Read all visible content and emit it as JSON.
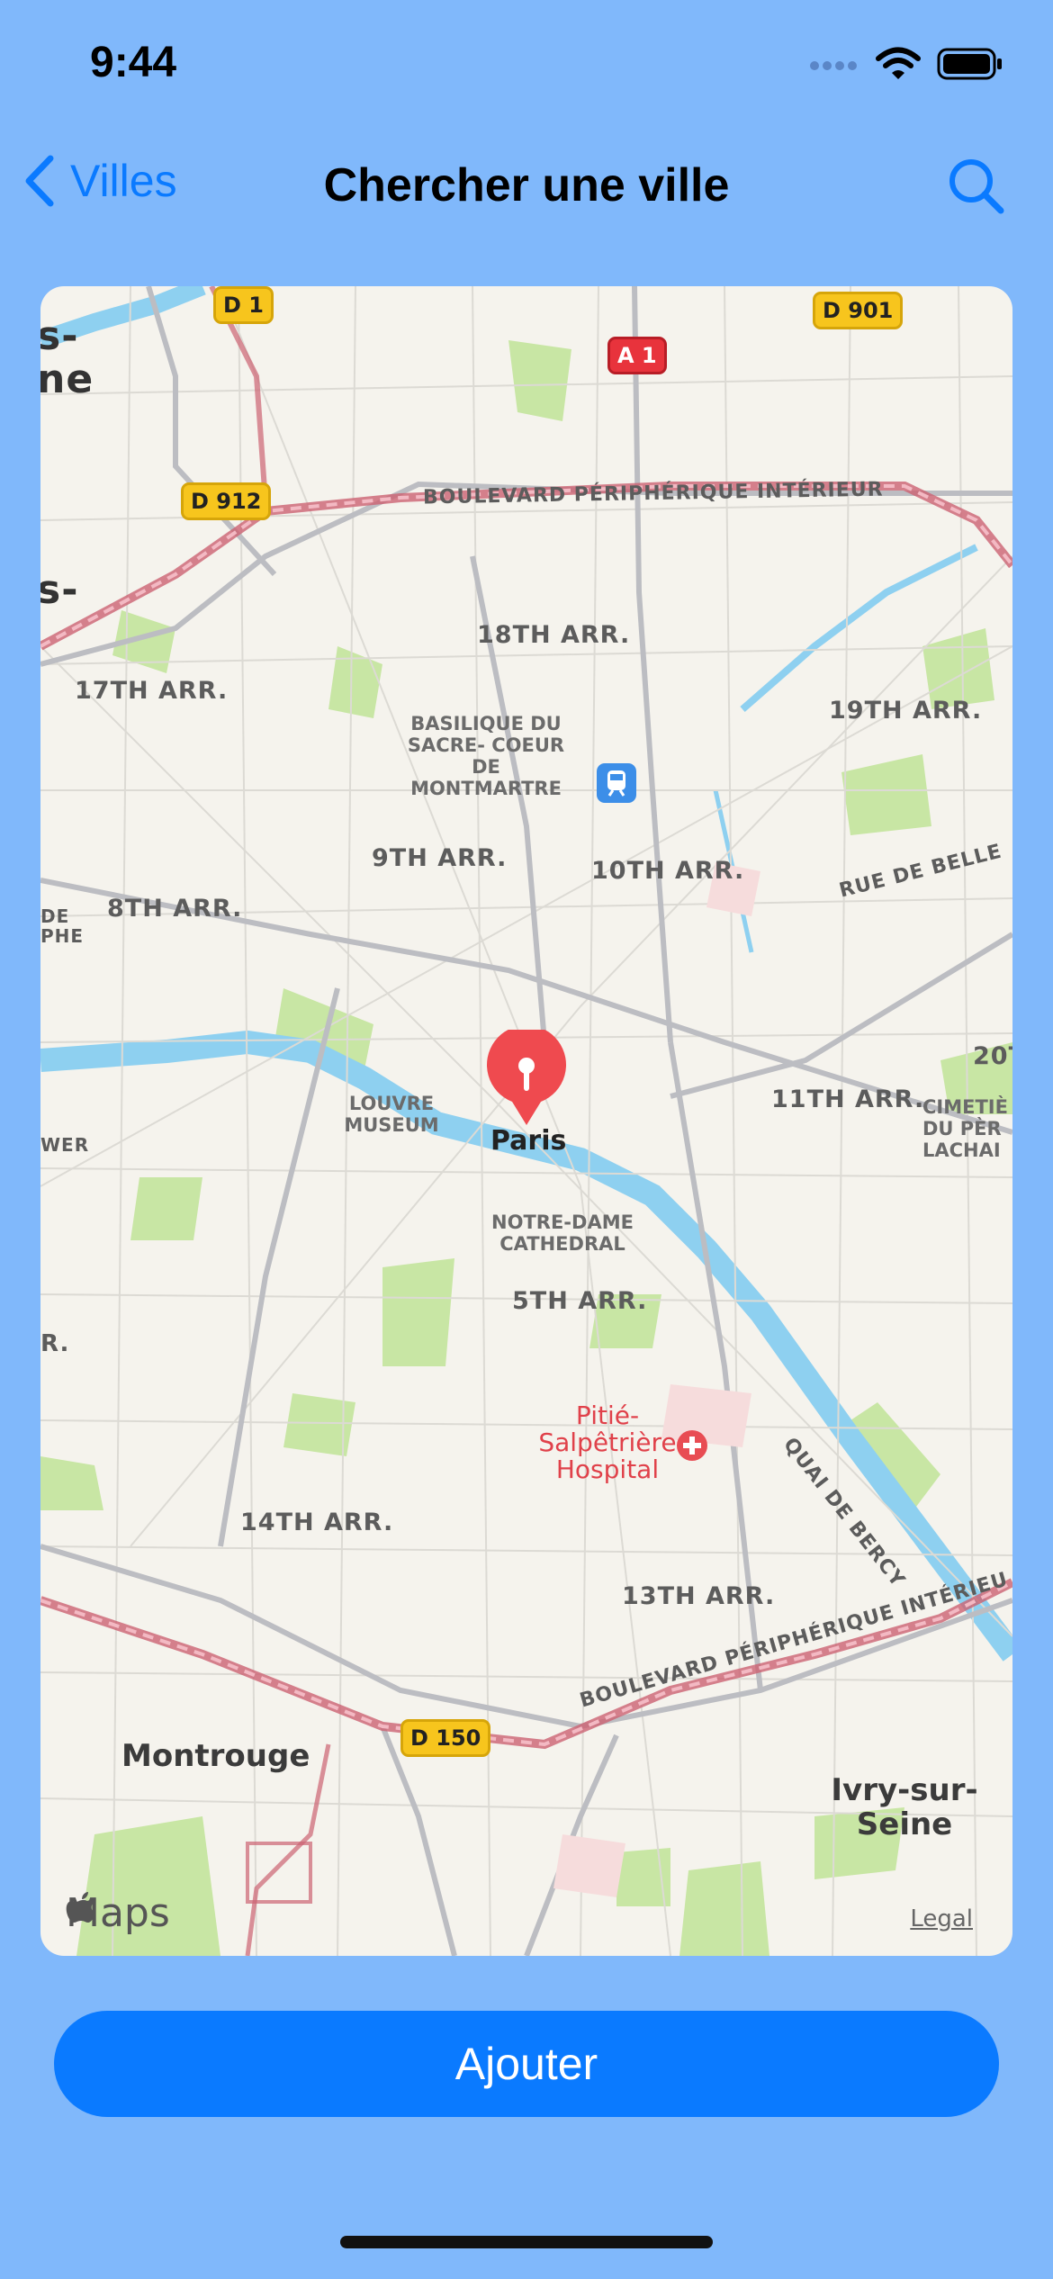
{
  "status": {
    "time": "9:44"
  },
  "nav": {
    "back_label": "Villes",
    "title": "Chercher une ville"
  },
  "map": {
    "pin_label": "Paris",
    "districts": [
      "18TH ARR.",
      "17TH ARR.",
      "19TH ARR.",
      "9TH ARR.",
      "10TH ARR.",
      "8TH ARR.",
      "11TH ARR.",
      "5TH ARR.",
      "14TH ARR.",
      "13TH ARR.",
      "20T"
    ],
    "roads": {
      "periph_top": "BOULEVARD PÉRIPHÉRIQUE INTÉRIEUR",
      "periph_bottom": "BOULEVARD PÉRIPHÉRIQUE INTÉRIEU",
      "belleville": "RUE DE BELLE",
      "bercy": "QUAI DE BERCY"
    },
    "landmarks": {
      "sacre_coeur": "BASILIQUE DU SACRE- COEUR DE MONTMARTRE",
      "louvre": "LOUVRE MUSEUM",
      "notre_dame": "NOTRE-DAME CATHEDRAL",
      "pere_lachaise": "CIMETIÈ DU PÈR LACHAI",
      "hospital": "Pitié- Salpêtrière Hospital"
    },
    "cities": {
      "montrouge": "Montrouge",
      "ivry": "Ivry-sur- Seine"
    },
    "shields": {
      "d1": "D 1",
      "a1": "A 1",
      "d901": "D 901",
      "d912": "D 912",
      "d150": "D 150"
    },
    "edge_fragments": {
      "left1": "s-",
      "left2": "ne",
      "left3": "s-",
      "left4": "DE",
      "left5": "PHE",
      "left6": "WER",
      "left7": "R."
    },
    "logo": "Maps",
    "legal": "Legal"
  },
  "actions": {
    "add_label": "Ajouter"
  },
  "colors": {
    "background": "#80b8fb",
    "accent": "#0a7aff",
    "pin": "#ef4a4f"
  }
}
